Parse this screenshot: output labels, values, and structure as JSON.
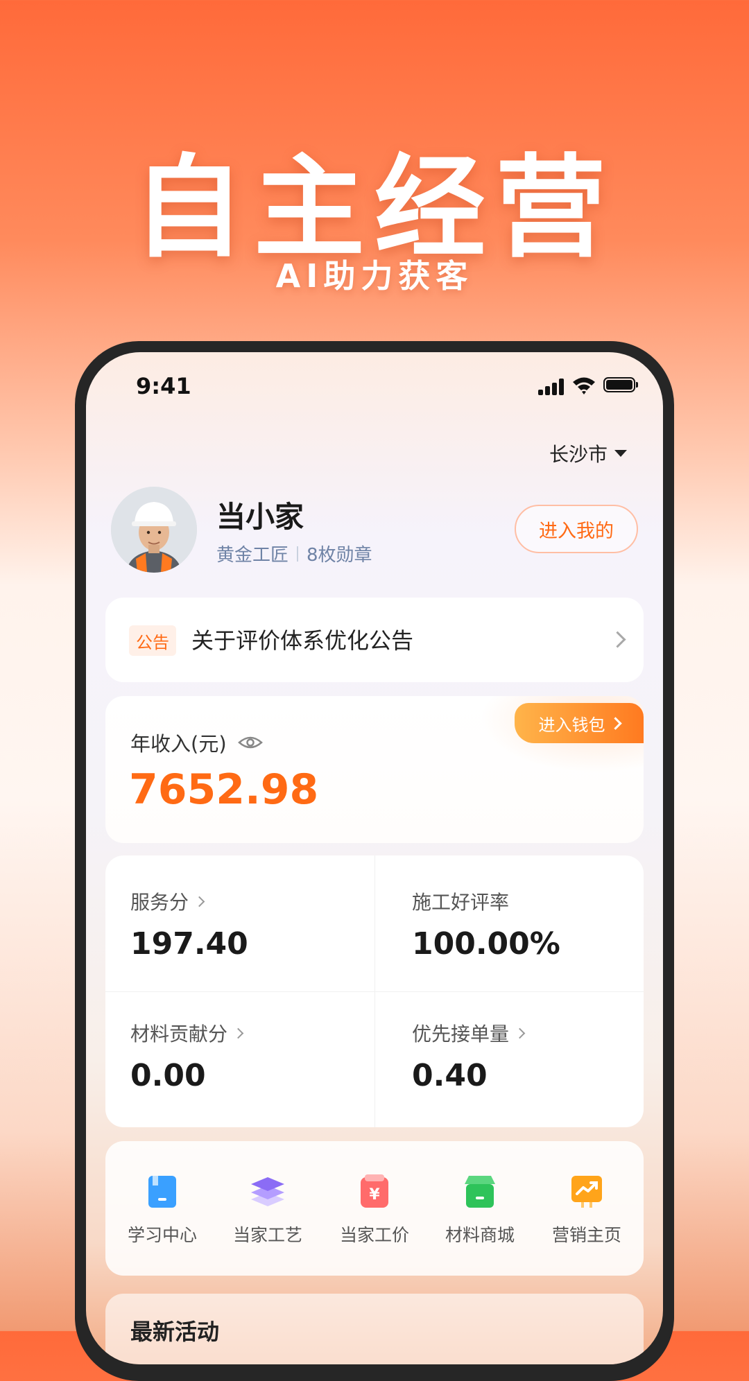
{
  "hero": {
    "title": "自主经营",
    "subtitle": "AI助力获客"
  },
  "status_bar": {
    "time": "9:41"
  },
  "location": {
    "city": "长沙市"
  },
  "profile": {
    "name": "当小家",
    "level": "黄金工匠",
    "badges": "8枚勋章",
    "enter_button": "进入我的"
  },
  "notice": {
    "tag": "公告",
    "text": "关于评价体系优化公告"
  },
  "income": {
    "label": "年收入(元)",
    "value": "7652.98",
    "wallet_button": "进入钱包"
  },
  "stats": [
    {
      "label": "服务分",
      "value": "197.40",
      "has_arrow": true
    },
    {
      "label": "施工好评率",
      "value": "100.00%",
      "has_arrow": false
    },
    {
      "label": "材料贡献分",
      "value": "0.00",
      "has_arrow": true
    },
    {
      "label": "优先接单量",
      "value": "0.40",
      "has_arrow": true
    }
  ],
  "tools": [
    {
      "label": "学习中心",
      "icon": "book-icon",
      "color": "#3aa0ff"
    },
    {
      "label": "当家工艺",
      "icon": "layers-icon",
      "color": "#8b6cf5"
    },
    {
      "label": "当家工价",
      "icon": "price-tag-icon",
      "color": "#ff5f5f"
    },
    {
      "label": "材料商城",
      "icon": "store-icon",
      "color": "#2ec35a"
    },
    {
      "label": "营销主页",
      "icon": "trend-icon",
      "color": "#ff9f1a"
    }
  ],
  "activity": {
    "title": "最新活动"
  }
}
